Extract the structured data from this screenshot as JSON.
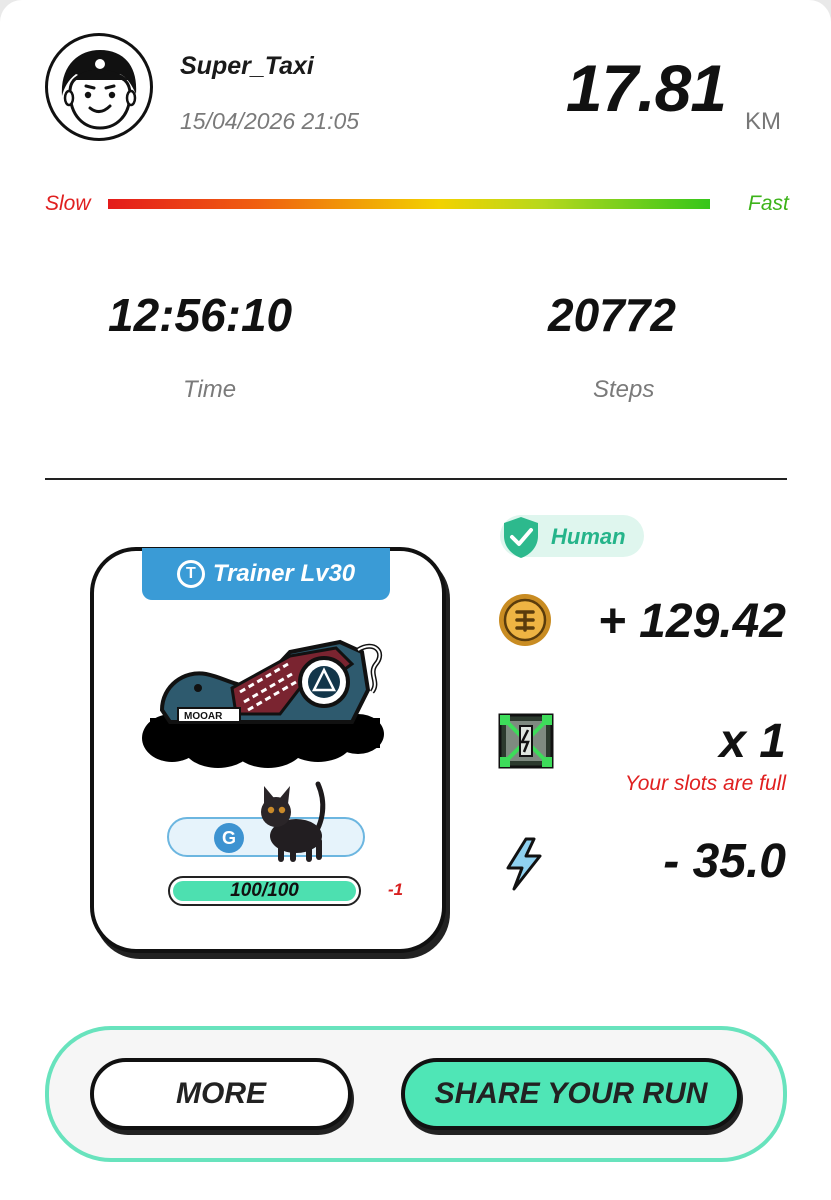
{
  "user": {
    "username": "Super_Taxi",
    "datetime": "15/04/2026 21:05"
  },
  "run": {
    "distance": "17.81",
    "distance_unit": "KM",
    "speed_scale": {
      "slow_label": "Slow",
      "fast_label": "Fast"
    },
    "time_value": "12:56:10",
    "time_label": "Time",
    "steps_value": "20772",
    "steps_label": "Steps"
  },
  "shoe": {
    "level_label": "Trainer Lv30",
    "level_icon_letter": "T",
    "brand_text": "MOOAR",
    "gem_icon_letter": "G",
    "durability_text": "100/100",
    "durability_fraction": 1.0,
    "durability_change": "-1"
  },
  "rewards": {
    "verification_label": "Human",
    "coin_amount": "+ 129.42",
    "box_count": "x 1",
    "slots_message": "Your slots are full",
    "energy_change": "- 35.0"
  },
  "actions": {
    "more_label": "MORE",
    "share_label": "SHARE YOUR RUN"
  },
  "colors": {
    "accent_mint": "#4fe6b6",
    "level_blue": "#3a9bd6",
    "alert_red": "#e02020",
    "human_green": "#25b48a"
  },
  "icons": [
    "avatar-face-icon",
    "shield-check-icon",
    "gmt-coin-icon",
    "mystery-box-icon",
    "lightning-bolt-icon",
    "trainer-t-icon",
    "gem-g-icon",
    "cat-pet-icon"
  ]
}
